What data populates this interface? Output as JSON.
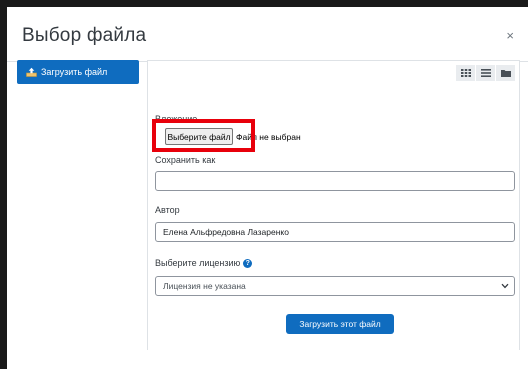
{
  "dialog": {
    "title": "Выбор файла",
    "close_label": "×"
  },
  "sidebar": {
    "items": [
      {
        "label": "Загрузить файл",
        "icon": "upload-icon"
      }
    ]
  },
  "toolbar": {
    "views": [
      "grid-view-icon",
      "list-view-icon",
      "folder-view-icon"
    ]
  },
  "form": {
    "attachment_label": "Вложение",
    "file_button_label": "Выберите файл",
    "file_status": "Файл не выбран",
    "save_as_label": "Сохранить как",
    "save_as_value": "",
    "author_label": "Автор",
    "author_value": "Елена Альфредовна Лазаренко",
    "license_label": "Выберите лицензию",
    "license_value": "Лицензия не указана",
    "submit_label": "Загрузить этот файл"
  },
  "colors": {
    "accent": "#0f6cbf",
    "highlight": "#e8000b"
  }
}
